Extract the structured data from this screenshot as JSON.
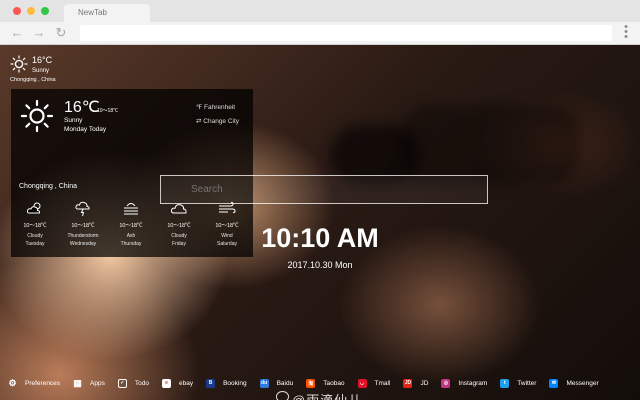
{
  "browser": {
    "tab_title": "NewTab",
    "traffic_colors": [
      "#fc5753",
      "#fdbc40",
      "#33c748"
    ]
  },
  "mini_weather": {
    "temp": "16°C",
    "condition": "Sunny",
    "city": "Chongqing , China",
    "icon": "sun-icon"
  },
  "weather_panel": {
    "temp": "16℃",
    "range": "10～18℃",
    "condition": "Sunny",
    "today_label": "Monday Today",
    "city": "Chongqing , China",
    "fahrenheit_label": "Fahrenheit",
    "change_city_label": "Change City",
    "forecast": [
      {
        "icon": "cloudy-icon",
        "range": "10～18℃",
        "condition": "Cloudy",
        "day": "Tuesday"
      },
      {
        "icon": "thunderstorm-icon",
        "range": "10～18℃",
        "condition": "Thunderstorm",
        "day": "Wednesday"
      },
      {
        "icon": "ash-icon",
        "range": "10～18℃",
        "condition": "Ash",
        "day": "Thursday"
      },
      {
        "icon": "cloud-icon",
        "range": "10～18℃",
        "condition": "Cloudy",
        "day": "Friday"
      },
      {
        "icon": "wind-icon",
        "range": "10～18℃",
        "condition": "Wind",
        "day": "Saturday"
      }
    ]
  },
  "search": {
    "placeholder": "Search"
  },
  "clock": {
    "time": "10:10 AM",
    "date": "2017.10.30 Mon"
  },
  "bottom_bar": {
    "items": [
      {
        "label": "Preferences",
        "icon": "gear-icon",
        "color": "#ffffff",
        "glyph": "⚙"
      },
      {
        "label": "Apps",
        "icon": "apps-icon",
        "color": "#ffffff",
        "glyph": "▦"
      },
      {
        "label": "Todo",
        "icon": "todo-icon",
        "color": "#ffffff",
        "glyph": "✓"
      },
      {
        "label": "ebay",
        "icon": "ebay-icon",
        "color": "#ffffff",
        "glyph": "e"
      },
      {
        "label": "Booking",
        "icon": "booking-icon",
        "color": "#1a3b8c",
        "glyph": "B"
      },
      {
        "label": "Baidu",
        "icon": "baidu-icon",
        "color": "#2d7de0",
        "glyph": "du"
      },
      {
        "label": "Taobao",
        "icon": "taobao-icon",
        "color": "#ff5000",
        "glyph": "淘"
      },
      {
        "label": "Tmall",
        "icon": "tmall-icon",
        "color": "#e3112a",
        "glyph": "◡"
      },
      {
        "label": "JD",
        "icon": "jd-icon",
        "color": "#e1251b",
        "glyph": "JD"
      },
      {
        "label": "Instagram",
        "icon": "instagram-icon",
        "color": "#c13584",
        "glyph": "◎"
      },
      {
        "label": "Twitter",
        "icon": "twitter-icon",
        "color": "#1da1f2",
        "glyph": "t"
      },
      {
        "label": "Messenger",
        "icon": "messenger-icon",
        "color": "#0084ff",
        "glyph": "✉"
      }
    ]
  },
  "watermark": {
    "text": "@雨滴仙儿"
  }
}
